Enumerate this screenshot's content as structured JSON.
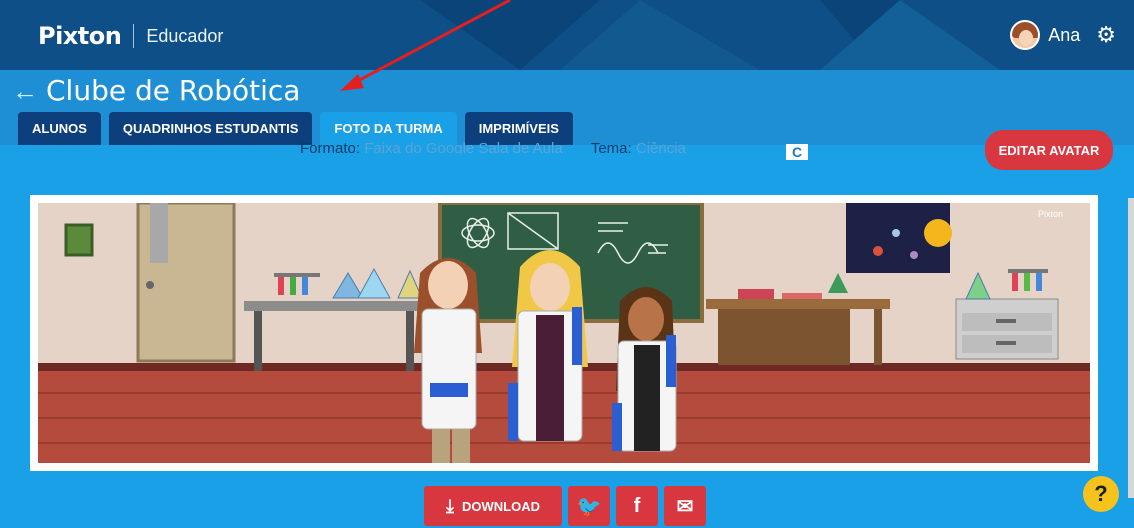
{
  "header": {
    "logo": "Pixton",
    "product": "Educador",
    "user_name": "Ana",
    "settings_icon": "gear-icon"
  },
  "title_bar": {
    "back_icon": "arrow-left-icon",
    "title": "Clube de Robótica"
  },
  "tabs": [
    {
      "label": "ALUNOS"
    },
    {
      "label": "QUADRINHOS ESTUDANTIS"
    },
    {
      "label": "FOTO DA TURMA",
      "active": true
    },
    {
      "label": "IMPRIMÍVEIS"
    }
  ],
  "options": {
    "format_label": "Formato:",
    "format_value": "Faixa do Google Sala de Aula",
    "theme_label": "Tema:",
    "theme_value": "Ciência"
  },
  "edit_avatar_label": "EDITAR AVATAR",
  "scene": {
    "watermark": "Pixton"
  },
  "actions": {
    "download_label": "DOWNLOAD",
    "share_icons": [
      "twitter-icon",
      "facebook-icon",
      "email-icon"
    ]
  },
  "help_label": "?",
  "colors": {
    "header": "#0d4f86",
    "background": "#1aa0e6",
    "accent_red": "#d9373f",
    "tab_dark": "#0e3f7d",
    "help_yellow": "#f7c21c"
  }
}
